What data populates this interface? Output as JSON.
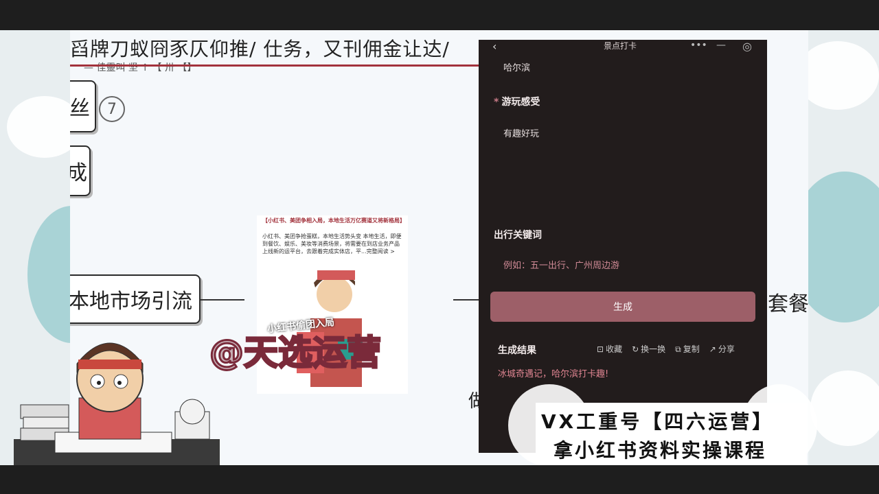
{
  "mindmap": {
    "top_text": "舀牌刀蚁冏豕仄仰推/ 仕务，又刊佣金让达/",
    "sub_text": "— 佳靈叫 坚 ↑ 【 卅 【】",
    "node_fans": "丝",
    "node_fans_num": "7",
    "node_cheng": "成",
    "node_local": "本地市场引流",
    "right_text": "套餐",
    "bottom_text": "做的"
  },
  "center_image": {
    "title": "【小红书、美团争相入局，本地生活万亿赛道又将新格局】",
    "body": "小红书、美团争抢蛋糕，本地生活势头变 本地生活，即便到餐饮、娱乐、美妆等消费场景，将需要在到店业务产品上线新的运平台，去跟着完成实体店，平...完整阅读 >",
    "caption": "小红书偷团入局"
  },
  "watermark": "@天选运营",
  "app": {
    "title": "景点打卡",
    "back": "‹",
    "controls": [
      "•••",
      "—",
      "◎"
    ],
    "location_value": "哈尔滨",
    "experience_label": "游玩感受",
    "experience_value": "有趣好玩",
    "keywords_label": "出行关键词",
    "keywords_placeholder": "例如：五一出行、广州周边游",
    "generate_label": "生成",
    "result_label": "生成结果",
    "actions": [
      {
        "icon": "bookmark-icon",
        "glyph": "⊡",
        "label": "收藏"
      },
      {
        "icon": "refresh-icon",
        "glyph": "↻",
        "label": "换一换"
      },
      {
        "icon": "copy-icon",
        "glyph": "⧉",
        "label": "复制"
      },
      {
        "icon": "share-icon",
        "glyph": "↗",
        "label": "分享"
      }
    ],
    "result_text": "冰城奇遇记，哈尔滨打卡趣!"
  },
  "banner": {
    "line1": "VX工重号【四六运营】",
    "line2": "拿小红书资料实操课程"
  },
  "colors": {
    "accent": "#a2323c",
    "panel_bg": "#221c1c",
    "button": "#9d5f68"
  }
}
